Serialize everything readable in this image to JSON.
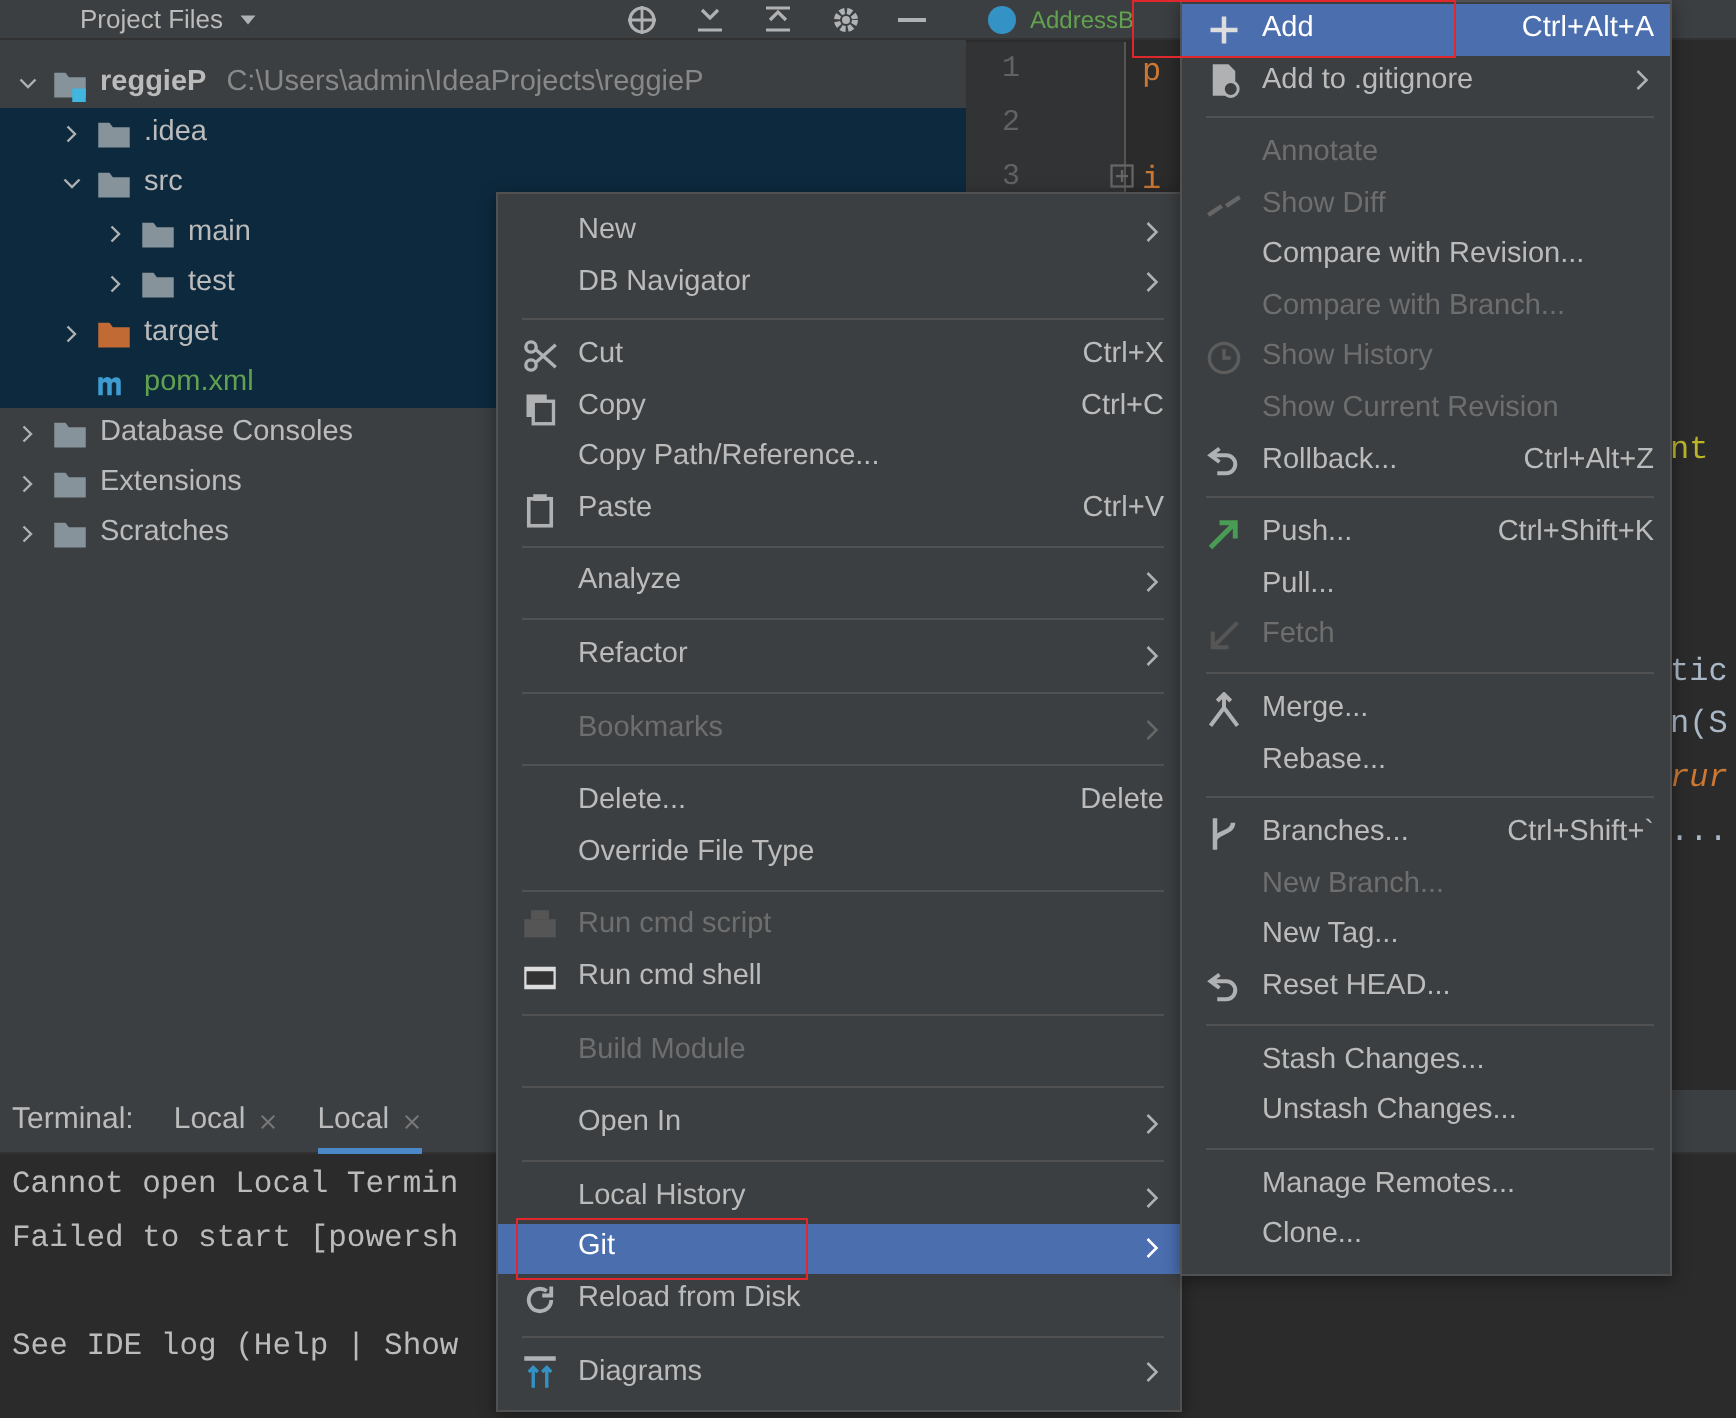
{
  "project_panel": {
    "title": "Project Files",
    "tree": [
      {
        "label": "reggieP",
        "path": "C:\\Users\\admin\\IdeaProjects\\reggieP",
        "kind": "module",
        "expanded": true,
        "selected": false,
        "children": [
          {
            "label": ".idea",
            "kind": "folder",
            "expanded": false,
            "selected": true
          },
          {
            "label": "src",
            "kind": "folder",
            "expanded": true,
            "selected": true,
            "children": [
              {
                "label": "main",
                "kind": "folder",
                "expanded": false,
                "selected": true
              },
              {
                "label": "test",
                "kind": "folder",
                "expanded": false,
                "selected": true
              }
            ]
          },
          {
            "label": "target",
            "kind": "excluded",
            "expanded": false,
            "selected": true
          },
          {
            "label": "pom.xml",
            "kind": "maven",
            "selected": true
          }
        ]
      },
      {
        "label": "Database Consoles",
        "kind": "folder",
        "expanded": false,
        "selected": false
      },
      {
        "label": "Extensions",
        "kind": "folder",
        "expanded": false,
        "selected": false
      },
      {
        "label": "Scratches",
        "kind": "folder",
        "expanded": false,
        "selected": false
      }
    ]
  },
  "editor": {
    "tab": "AddressB",
    "line_numbers": [
      "1",
      "2",
      "3"
    ],
    "code_fragments": [
      "p",
      "i",
      "nt",
      "tic",
      "n(S",
      "rur",
      "..."
    ]
  },
  "terminal": {
    "label": "Terminal:",
    "tabs": [
      {
        "label": "Local",
        "selected": false
      },
      {
        "label": "Local",
        "selected": true
      }
    ],
    "lines": [
      "Cannot open Local Termin",
      "Failed to start [powersh",
      "See IDE log (Help | Show"
    ]
  },
  "context_menu": [
    {
      "kind": "item",
      "label": "New",
      "submenu": true,
      "disabled": false,
      "selected": false,
      "annotated": false
    },
    {
      "kind": "item",
      "label": "DB Navigator",
      "submenu": true,
      "disabled": false,
      "selected": false,
      "annotated": false
    },
    {
      "kind": "separator"
    },
    {
      "kind": "item",
      "label": "Cut",
      "shortcut": "Ctrl+X",
      "submenu": false,
      "disabled": false,
      "selected": false,
      "annotated": false
    },
    {
      "kind": "item",
      "label": "Copy",
      "shortcut": "Ctrl+C",
      "submenu": false,
      "disabled": false,
      "selected": false,
      "annotated": false
    },
    {
      "kind": "item",
      "label": "Copy Path/Reference...",
      "submenu": false,
      "disabled": false,
      "selected": false,
      "annotated": false
    },
    {
      "kind": "item",
      "label": "Paste",
      "shortcut": "Ctrl+V",
      "submenu": false,
      "disabled": false,
      "selected": false,
      "annotated": false
    },
    {
      "kind": "separator"
    },
    {
      "kind": "item",
      "label": "Analyze",
      "submenu": true,
      "disabled": false,
      "selected": false,
      "annotated": false
    },
    {
      "kind": "separator"
    },
    {
      "kind": "item",
      "label": "Refactor",
      "submenu": true,
      "disabled": false,
      "selected": false,
      "annotated": false
    },
    {
      "kind": "separator"
    },
    {
      "kind": "item",
      "label": "Bookmarks",
      "submenu": true,
      "disabled": true,
      "selected": false,
      "annotated": false
    },
    {
      "kind": "separator"
    },
    {
      "kind": "item",
      "label": "Delete...",
      "shortcut": "Delete",
      "submenu": false,
      "disabled": false,
      "selected": false,
      "annotated": false
    },
    {
      "kind": "item",
      "label": "Override File Type",
      "submenu": false,
      "disabled": false,
      "selected": false,
      "annotated": false
    },
    {
      "kind": "separator"
    },
    {
      "kind": "item",
      "label": "Run cmd script",
      "submenu": false,
      "disabled": true,
      "selected": false,
      "annotated": false
    },
    {
      "kind": "item",
      "label": "Run cmd shell",
      "submenu": false,
      "disabled": false,
      "selected": false,
      "annotated": false
    },
    {
      "kind": "separator"
    },
    {
      "kind": "item",
      "label": "Build Module",
      "submenu": false,
      "disabled": true,
      "selected": false,
      "annotated": false
    },
    {
      "kind": "separator"
    },
    {
      "kind": "item",
      "label": "Open In",
      "submenu": true,
      "disabled": false,
      "selected": false,
      "annotated": false
    },
    {
      "kind": "separator"
    },
    {
      "kind": "item",
      "label": "Local History",
      "submenu": true,
      "disabled": false,
      "selected": false,
      "annotated": false
    },
    {
      "kind": "item",
      "label": "Git",
      "submenu": true,
      "disabled": false,
      "selected": true,
      "annotated": true
    },
    {
      "kind": "item",
      "label": "Reload from Disk",
      "submenu": false,
      "disabled": false,
      "selected": false,
      "annotated": false
    },
    {
      "kind": "separator"
    },
    {
      "kind": "item",
      "label": "Diagrams",
      "submenu": true,
      "disabled": false,
      "selected": false,
      "annotated": false
    }
  ],
  "git_menu": [
    {
      "kind": "item",
      "label": "Add",
      "shortcut": "Ctrl+Alt+A",
      "submenu": false,
      "disabled": false,
      "selected": true,
      "annotated": true
    },
    {
      "kind": "item",
      "label": "Add to .gitignore",
      "submenu": true,
      "disabled": false,
      "selected": false,
      "annotated": false
    },
    {
      "kind": "separator"
    },
    {
      "kind": "item",
      "label": "Annotate",
      "submenu": false,
      "disabled": true,
      "selected": false,
      "annotated": false
    },
    {
      "kind": "item",
      "label": "Show Diff",
      "submenu": false,
      "disabled": true,
      "selected": false,
      "annotated": false
    },
    {
      "kind": "item",
      "label": "Compare with Revision...",
      "submenu": false,
      "disabled": false,
      "selected": false,
      "annotated": false
    },
    {
      "kind": "item",
      "label": "Compare with Branch...",
      "submenu": false,
      "disabled": true,
      "selected": false,
      "annotated": false
    },
    {
      "kind": "item",
      "label": "Show History",
      "submenu": false,
      "disabled": true,
      "selected": false,
      "annotated": false
    },
    {
      "kind": "item",
      "label": "Show Current Revision",
      "submenu": false,
      "disabled": true,
      "selected": false,
      "annotated": false
    },
    {
      "kind": "item",
      "label": "Rollback...",
      "shortcut": "Ctrl+Alt+Z",
      "submenu": false,
      "disabled": false,
      "selected": false,
      "annotated": false
    },
    {
      "kind": "separator"
    },
    {
      "kind": "item",
      "label": "Push...",
      "shortcut": "Ctrl+Shift+K",
      "submenu": false,
      "disabled": false,
      "selected": false,
      "annotated": false
    },
    {
      "kind": "item",
      "label": "Pull...",
      "submenu": false,
      "disabled": false,
      "selected": false,
      "annotated": false
    },
    {
      "kind": "item",
      "label": "Fetch",
      "submenu": false,
      "disabled": true,
      "selected": false,
      "annotated": false
    },
    {
      "kind": "separator"
    },
    {
      "kind": "item",
      "label": "Merge...",
      "submenu": false,
      "disabled": false,
      "selected": false,
      "annotated": false
    },
    {
      "kind": "item",
      "label": "Rebase...",
      "submenu": false,
      "disabled": false,
      "selected": false,
      "annotated": false
    },
    {
      "kind": "separator"
    },
    {
      "kind": "item",
      "label": "Branches...",
      "shortcut": "Ctrl+Shift+`",
      "submenu": false,
      "disabled": false,
      "selected": false,
      "annotated": false
    },
    {
      "kind": "item",
      "label": "New Branch...",
      "submenu": false,
      "disabled": true,
      "selected": false,
      "annotated": false
    },
    {
      "kind": "item",
      "label": "New Tag...",
      "submenu": false,
      "disabled": false,
      "selected": false,
      "annotated": false
    },
    {
      "kind": "item",
      "label": "Reset HEAD...",
      "submenu": false,
      "disabled": false,
      "selected": false,
      "annotated": false
    },
    {
      "kind": "separator"
    },
    {
      "kind": "item",
      "label": "Stash Changes...",
      "submenu": false,
      "disabled": false,
      "selected": false,
      "annotated": false
    },
    {
      "kind": "item",
      "label": "Unstash Changes...",
      "submenu": false,
      "disabled": false,
      "selected": false,
      "annotated": false
    },
    {
      "kind": "separator"
    },
    {
      "kind": "item",
      "label": "Manage Remotes...",
      "submenu": false,
      "disabled": false,
      "selected": false,
      "annotated": false
    },
    {
      "kind": "item",
      "label": "Clone...",
      "submenu": false,
      "disabled": false,
      "selected": false,
      "annotated": false
    }
  ]
}
